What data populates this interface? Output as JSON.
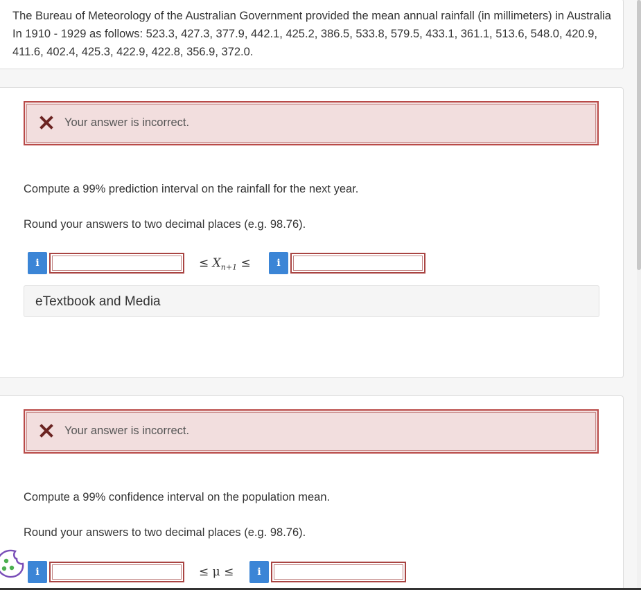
{
  "intro": {
    "text": "The Bureau of Meteorology of the Australian Government provided the mean annual rainfall (in millimeters) in Australia In 1910 - 1929 as follows: 523.3, 427.3, 377.9, 442.1, 425.2, 386.5, 533.8, 579.5, 433.1, 361.1, 513.6, 548.0, 420.9, 411.6, 402.4, 425.3, 422.9, 422.8, 356.9, 372.0."
  },
  "q1": {
    "feedback": "Your answer is incorrect.",
    "prompt": "Compute a 99% prediction interval on the rainfall for the next year.",
    "round_note": "Round your answers to two decimal places (e.g. 98.76).",
    "lower_value": "",
    "upper_value": "",
    "info_label": "i",
    "ineq_left": "≤",
    "var_name": "X",
    "var_sub": "n+1",
    "ineq_right": "≤",
    "etextbook_label": "eTextbook and Media"
  },
  "q2": {
    "feedback": "Your answer is incorrect.",
    "prompt": "Compute a 99% confidence interval on the population mean.",
    "round_note": "Round your answers to two decimal places (e.g. 98.76).",
    "lower_value": "",
    "upper_value": "",
    "info_label": "i",
    "ineq_text": "≤ μ ≤"
  },
  "colors": {
    "error_border": "#b94a48",
    "error_bg": "#f2dede",
    "info_blue": "#3b85d6"
  },
  "icons": {
    "feedback": "x-mark-icon",
    "info": "info-icon",
    "cookie": "cookie-icon"
  }
}
